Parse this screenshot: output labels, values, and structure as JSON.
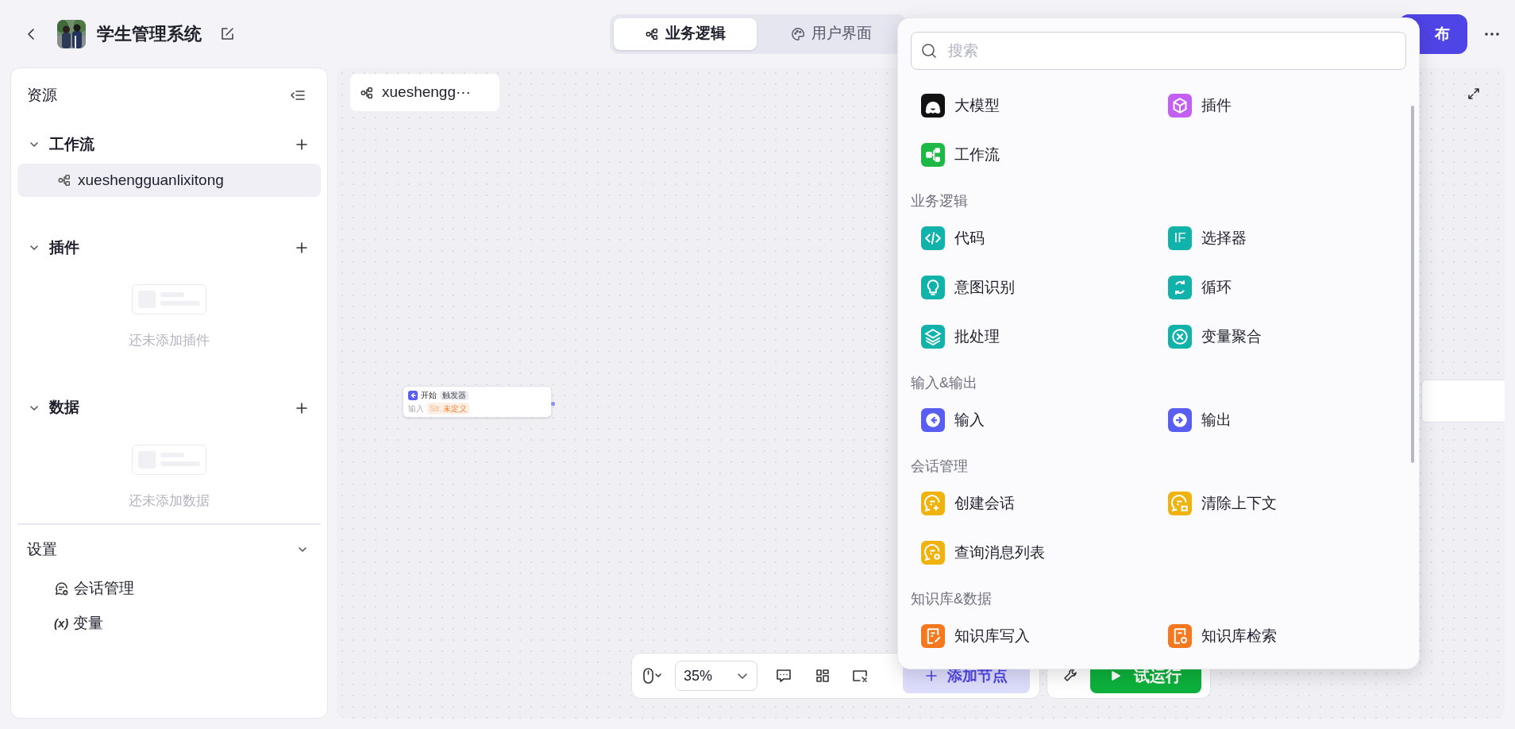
{
  "header": {
    "title": "学生管理系统",
    "tabs": [
      {
        "label": "业务逻辑",
        "selected": true
      },
      {
        "label": "用户界面",
        "selected": false
      }
    ],
    "publish_button": "布"
  },
  "sidebar": {
    "title": "资源",
    "sections": [
      {
        "title": "工作流",
        "expanded": true,
        "items": [
          {
            "label": "xueshengguanlixitong",
            "selected": true
          }
        ]
      },
      {
        "title": "插件",
        "expanded": true,
        "empty_text": "还未添加插件"
      },
      {
        "title": "数据",
        "expanded": true,
        "empty_text": "还未添加数据"
      }
    ],
    "settings": {
      "title": "设置",
      "expanded": true,
      "items": [
        {
          "label": "会话管理"
        },
        {
          "label": "变量",
          "icon_text": "(x)"
        }
      ]
    }
  },
  "canvas": {
    "tab": "xueshengg···",
    "start_node": {
      "title": "开始",
      "badge": "触发器",
      "input_label": "输入",
      "type_tag": "Str.",
      "value_tag": "未定义"
    }
  },
  "toolbar": {
    "zoom": "35%",
    "add_node_button": "添加节点",
    "run_button": "试运行"
  },
  "node_menu": {
    "search": {
      "placeholder": "搜索"
    },
    "groups": [
      {
        "items": [
          {
            "label": "大模型",
            "color": "#111111"
          },
          {
            "label": "插件",
            "color": "#c35ff2"
          },
          {
            "label": "工作流",
            "color": "#1db845"
          }
        ]
      },
      {
        "heading": "业务逻辑",
        "items": [
          {
            "label": "代码",
            "color": "#10b2aa"
          },
          {
            "label": "选择器",
            "color": "#10b2aa",
            "icon_text": "IF"
          },
          {
            "label": "意图识别",
            "color": "#10b2aa"
          },
          {
            "label": "循环",
            "color": "#10b2aa"
          },
          {
            "label": "批处理",
            "color": "#10b2aa"
          },
          {
            "label": "变量聚合",
            "color": "#10b2aa"
          }
        ]
      },
      {
        "heading": "输入&输出",
        "items": [
          {
            "label": "输入",
            "color": "#5a5df2"
          },
          {
            "label": "输出",
            "color": "#5a5df2"
          }
        ]
      },
      {
        "heading": "会话管理",
        "items": [
          {
            "label": "创建会话",
            "color": "#f0b20c"
          },
          {
            "label": "清除上下文",
            "color": "#f0b20c"
          },
          {
            "label": "查询消息列表",
            "color": "#f0b20c"
          }
        ]
      },
      {
        "heading": "知识库&数据",
        "items": [
          {
            "label": "知识库写入",
            "color": "#f5781f"
          },
          {
            "label": "知识库检索",
            "color": "#f5781f"
          }
        ]
      }
    ]
  }
}
